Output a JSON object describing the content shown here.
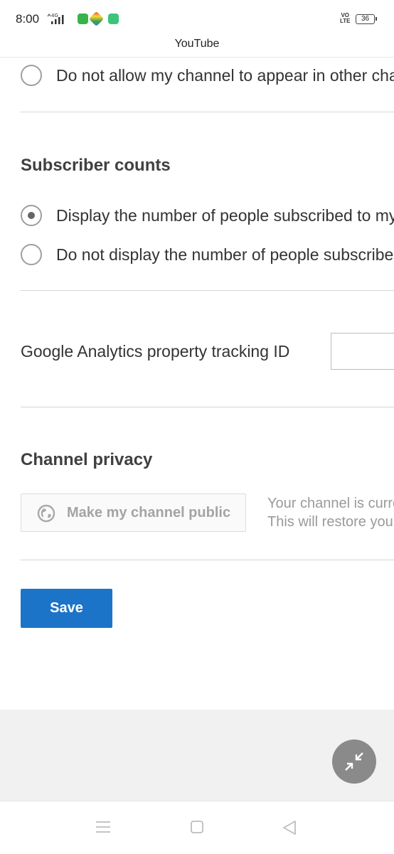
{
  "status_bar": {
    "time": "8:00",
    "network": "4G",
    "volte_line1": "VO",
    "volte_line2": "LTE",
    "battery": "36",
    "icons": [
      "signal-icon",
      "green-app-icon",
      "colorful-app-icon",
      "chat-app-icon"
    ]
  },
  "app": {
    "title": "YouTube"
  },
  "channel_visibility": {
    "option_no_allow": "Do not allow my channel to appear in other channels' recommendations"
  },
  "subscriber_counts": {
    "title": "Subscriber counts",
    "options": [
      {
        "label": "Display the number of people subscribed to my channel",
        "selected": true
      },
      {
        "label": "Do not display the number of people subscribed to my channel",
        "selected": false
      }
    ]
  },
  "analytics": {
    "label": "Google Analytics property tracking ID",
    "value": ""
  },
  "channel_privacy": {
    "title": "Channel privacy",
    "button_label": "Make my channel public",
    "note_line1": "Your channel is currently hidden.",
    "note_line2": "This will restore your channel."
  },
  "actions": {
    "save_label": "Save"
  },
  "fab": {
    "icon": "minimize-arrows-icon"
  },
  "nav": {
    "icons": [
      "menu-icon",
      "home-square-icon",
      "back-triangle-icon"
    ]
  },
  "colors": {
    "primary": "#1c74c8",
    "background": "#f1f1f1",
    "fab": "#8a8a8a"
  }
}
